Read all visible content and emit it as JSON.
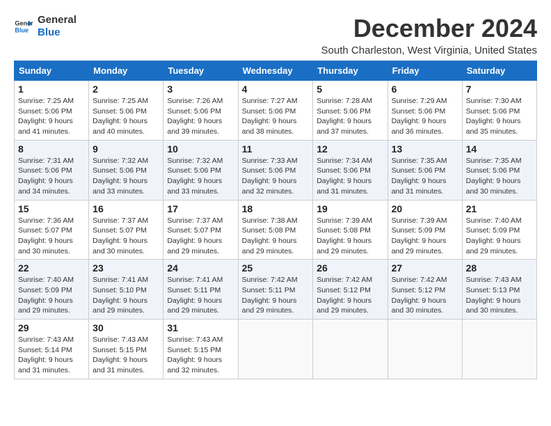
{
  "header": {
    "logo_line1": "General",
    "logo_line2": "Blue",
    "month_title": "December 2024",
    "location": "South Charleston, West Virginia, United States"
  },
  "weekdays": [
    "Sunday",
    "Monday",
    "Tuesday",
    "Wednesday",
    "Thursday",
    "Friday",
    "Saturday"
  ],
  "weeks": [
    [
      {
        "day": "1",
        "sunrise": "7:25 AM",
        "sunset": "5:06 PM",
        "daylight": "9 hours and 41 minutes."
      },
      {
        "day": "2",
        "sunrise": "7:25 AM",
        "sunset": "5:06 PM",
        "daylight": "9 hours and 40 minutes."
      },
      {
        "day": "3",
        "sunrise": "7:26 AM",
        "sunset": "5:06 PM",
        "daylight": "9 hours and 39 minutes."
      },
      {
        "day": "4",
        "sunrise": "7:27 AM",
        "sunset": "5:06 PM",
        "daylight": "9 hours and 38 minutes."
      },
      {
        "day": "5",
        "sunrise": "7:28 AM",
        "sunset": "5:06 PM",
        "daylight": "9 hours and 37 minutes."
      },
      {
        "day": "6",
        "sunrise": "7:29 AM",
        "sunset": "5:06 PM",
        "daylight": "9 hours and 36 minutes."
      },
      {
        "day": "7",
        "sunrise": "7:30 AM",
        "sunset": "5:06 PM",
        "daylight": "9 hours and 35 minutes."
      }
    ],
    [
      {
        "day": "8",
        "sunrise": "7:31 AM",
        "sunset": "5:06 PM",
        "daylight": "9 hours and 34 minutes."
      },
      {
        "day": "9",
        "sunrise": "7:32 AM",
        "sunset": "5:06 PM",
        "daylight": "9 hours and 33 minutes."
      },
      {
        "day": "10",
        "sunrise": "7:32 AM",
        "sunset": "5:06 PM",
        "daylight": "9 hours and 33 minutes."
      },
      {
        "day": "11",
        "sunrise": "7:33 AM",
        "sunset": "5:06 PM",
        "daylight": "9 hours and 32 minutes."
      },
      {
        "day": "12",
        "sunrise": "7:34 AM",
        "sunset": "5:06 PM",
        "daylight": "9 hours and 31 minutes."
      },
      {
        "day": "13",
        "sunrise": "7:35 AM",
        "sunset": "5:06 PM",
        "daylight": "9 hours and 31 minutes."
      },
      {
        "day": "14",
        "sunrise": "7:35 AM",
        "sunset": "5:06 PM",
        "daylight": "9 hours and 30 minutes."
      }
    ],
    [
      {
        "day": "15",
        "sunrise": "7:36 AM",
        "sunset": "5:07 PM",
        "daylight": "9 hours and 30 minutes."
      },
      {
        "day": "16",
        "sunrise": "7:37 AM",
        "sunset": "5:07 PM",
        "daylight": "9 hours and 30 minutes."
      },
      {
        "day": "17",
        "sunrise": "7:37 AM",
        "sunset": "5:07 PM",
        "daylight": "9 hours and 29 minutes."
      },
      {
        "day": "18",
        "sunrise": "7:38 AM",
        "sunset": "5:08 PM",
        "daylight": "9 hours and 29 minutes."
      },
      {
        "day": "19",
        "sunrise": "7:39 AM",
        "sunset": "5:08 PM",
        "daylight": "9 hours and 29 minutes."
      },
      {
        "day": "20",
        "sunrise": "7:39 AM",
        "sunset": "5:09 PM",
        "daylight": "9 hours and 29 minutes."
      },
      {
        "day": "21",
        "sunrise": "7:40 AM",
        "sunset": "5:09 PM",
        "daylight": "9 hours and 29 minutes."
      }
    ],
    [
      {
        "day": "22",
        "sunrise": "7:40 AM",
        "sunset": "5:09 PM",
        "daylight": "9 hours and 29 minutes."
      },
      {
        "day": "23",
        "sunrise": "7:41 AM",
        "sunset": "5:10 PM",
        "daylight": "9 hours and 29 minutes."
      },
      {
        "day": "24",
        "sunrise": "7:41 AM",
        "sunset": "5:11 PM",
        "daylight": "9 hours and 29 minutes."
      },
      {
        "day": "25",
        "sunrise": "7:42 AM",
        "sunset": "5:11 PM",
        "daylight": "9 hours and 29 minutes."
      },
      {
        "day": "26",
        "sunrise": "7:42 AM",
        "sunset": "5:12 PM",
        "daylight": "9 hours and 29 minutes."
      },
      {
        "day": "27",
        "sunrise": "7:42 AM",
        "sunset": "5:12 PM",
        "daylight": "9 hours and 30 minutes."
      },
      {
        "day": "28",
        "sunrise": "7:43 AM",
        "sunset": "5:13 PM",
        "daylight": "9 hours and 30 minutes."
      }
    ],
    [
      {
        "day": "29",
        "sunrise": "7:43 AM",
        "sunset": "5:14 PM",
        "daylight": "9 hours and 31 minutes."
      },
      {
        "day": "30",
        "sunrise": "7:43 AM",
        "sunset": "5:15 PM",
        "daylight": "9 hours and 31 minutes."
      },
      {
        "day": "31",
        "sunrise": "7:43 AM",
        "sunset": "5:15 PM",
        "daylight": "9 hours and 32 minutes."
      },
      null,
      null,
      null,
      null
    ]
  ]
}
